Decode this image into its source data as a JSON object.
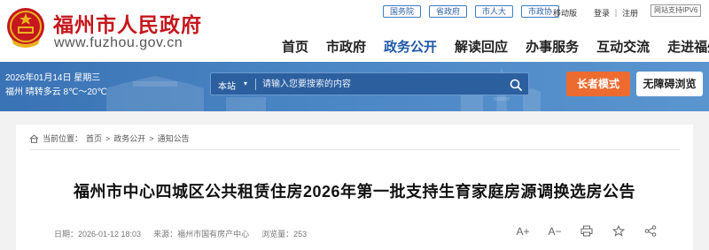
{
  "header": {
    "site_name": "福州市人民政府",
    "site_domain": "www.fuzhou.gov.cn",
    "top_links": [
      "国务院",
      "省政府",
      "市人大",
      "市政协"
    ],
    "mobile": "移动版",
    "login": "登录 ｜ 注册",
    "ipv6": "网站支持IPV6",
    "nav": [
      "首页",
      "市政府",
      "政务公开",
      "解读回应",
      "办事服务",
      "互动交流",
      "走进福州"
    ],
    "nav_active": "政务公开"
  },
  "banner": {
    "date": "2026年01月14日 星期三",
    "weather": "福州 晴转多云 8℃～20℃",
    "search_scope": "本站",
    "search_placeholder": "请输入您要搜索的内容",
    "elder_mode": "长者模式",
    "accessible": "无障碍浏览"
  },
  "breadcrumb": {
    "label": "当前位置：",
    "items": [
      "首页",
      "政务公开",
      "通知公告"
    ]
  },
  "article": {
    "title": "福州市中心四城区公共租赁住房2026年第一批支持生育家庭房源调换选房公告",
    "date": "日期：2026-01-12 18:03",
    "source": "来源：福州市国有房产中心",
    "views": "浏览量：253"
  },
  "tools": {
    "font_up": "A+",
    "font_down": "A−"
  },
  "colors": {
    "brand_red": "#c5171d",
    "nav_active": "#1f58a6",
    "banner_blue": "#4b86c4",
    "elder_orange": "#ee6b2f"
  }
}
